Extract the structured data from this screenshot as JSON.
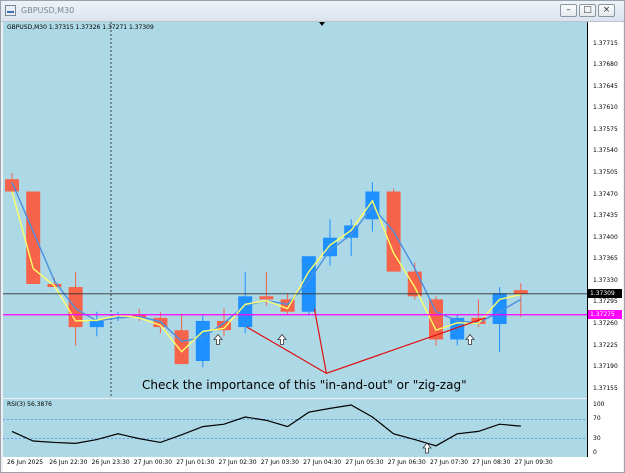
{
  "window": {
    "title": "GBPUSD,M30",
    "buttons": [
      "minimize",
      "maximize",
      "close"
    ]
  },
  "symbol_info": "GBPUSD,M30  1.37315 1.37326 1.37271 1.37309",
  "annotation": "Check the importance of this \"in-and-out\" or \"zig-zag\"",
  "price_axis": [
    "1.37715",
    "1.37680",
    "1.37645",
    "1.37610",
    "1.37575",
    "1.37540",
    "1.37505",
    "1.37470",
    "1.37435",
    "1.37400",
    "1.37365",
    "1.37330",
    "1.37295",
    "1.37260",
    "1.37225",
    "1.37190",
    "1.37155"
  ],
  "current_price": "1.37309",
  "level_price": "1.37275",
  "rsi_label": "RSI(3) 56.3876",
  "rsi_axis": [
    "100",
    "70",
    "30",
    "0"
  ],
  "time_axis": [
    "26 Jun 2025",
    "26 Jun 22:30",
    "26 Jun 23:30",
    "27 Jun 00:30",
    "27 Jun 01:30",
    "27 Jun 02:30",
    "27 Jun 03:30",
    "27 Jun 04:30",
    "27 Jun 05:30",
    "27 Jun 06:30",
    "27 Jun 07:30",
    "27 Jun 08:30",
    "27 Jun 09:30"
  ],
  "colors": {
    "background": "#add8e6",
    "bull": "#1e90ff",
    "bear": "#f4634a",
    "level": "#ff00ff",
    "zigzag": "#e01010",
    "ma_fast": "#ffff66",
    "ma_slow": "#4a90e2"
  },
  "chart_data": {
    "type": "candlestick",
    "y_range": [
      1.3714,
      1.3775
    ],
    "candles": [
      {
        "o": 1.37495,
        "h": 1.37505,
        "l": 1.37475,
        "c": 1.37475
      },
      {
        "o": 1.37475,
        "h": 1.37475,
        "l": 1.37325,
        "c": 1.37325
      },
      {
        "o": 1.37325,
        "h": 1.37335,
        "l": 1.3732,
        "c": 1.3732
      },
      {
        "o": 1.3732,
        "h": 1.37345,
        "l": 1.37225,
        "c": 1.37255
      },
      {
        "o": 1.37255,
        "h": 1.3728,
        "l": 1.3724,
        "c": 1.37265
      },
      {
        "o": 1.37275,
        "h": 1.3728,
        "l": 1.37265,
        "c": 1.37275
      },
      {
        "o": 1.37275,
        "h": 1.37285,
        "l": 1.37265,
        "c": 1.3727
      },
      {
        "o": 1.3727,
        "h": 1.3728,
        "l": 1.37245,
        "c": 1.37255
      },
      {
        "o": 1.3725,
        "h": 1.37275,
        "l": 1.37195,
        "c": 1.37195
      },
      {
        "o": 1.372,
        "h": 1.37275,
        "l": 1.3719,
        "c": 1.37265
      },
      {
        "o": 1.37265,
        "h": 1.37285,
        "l": 1.3724,
        "c": 1.3725
      },
      {
        "o": 1.37255,
        "h": 1.37345,
        "l": 1.37245,
        "c": 1.37305
      },
      {
        "o": 1.37305,
        "h": 1.37345,
        "l": 1.3729,
        "c": 1.373
      },
      {
        "o": 1.373,
        "h": 1.3731,
        "l": 1.37275,
        "c": 1.3728
      },
      {
        "o": 1.3728,
        "h": 1.37365,
        "l": 1.37275,
        "c": 1.3737
      },
      {
        "o": 1.3737,
        "h": 1.3743,
        "l": 1.37355,
        "c": 1.374
      },
      {
        "o": 1.374,
        "h": 1.3743,
        "l": 1.3737,
        "c": 1.3742
      },
      {
        "o": 1.3743,
        "h": 1.3749,
        "l": 1.3741,
        "c": 1.37475
      },
      {
        "o": 1.37475,
        "h": 1.3748,
        "l": 1.37345,
        "c": 1.37345
      },
      {
        "o": 1.37345,
        "h": 1.3736,
        "l": 1.373,
        "c": 1.37305
      },
      {
        "o": 1.373,
        "h": 1.37305,
        "l": 1.37225,
        "c": 1.37235
      },
      {
        "o": 1.37235,
        "h": 1.37275,
        "l": 1.37225,
        "c": 1.3727
      },
      {
        "o": 1.3727,
        "h": 1.373,
        "l": 1.37255,
        "c": 1.3726
      },
      {
        "o": 1.3726,
        "h": 1.3732,
        "l": 1.37215,
        "c": 1.3731
      },
      {
        "o": 1.37315,
        "h": 1.37326,
        "l": 1.37271,
        "c": 1.37309
      }
    ],
    "ma_fast": [
      1.37475,
      1.3735,
      1.37322,
      1.37265,
      1.37266,
      1.37274,
      1.3727,
      1.37258,
      1.37215,
      1.37248,
      1.37253,
      1.37292,
      1.37298,
      1.37285,
      1.37345,
      1.37388,
      1.37412,
      1.3746,
      1.37375,
      1.3732,
      1.3725,
      1.37262,
      1.37261,
      1.373,
      1.37308
    ],
    "ma_slow": [
      1.3749,
      1.3741,
      1.3733,
      1.37285,
      1.37265,
      1.3727,
      1.37272,
      1.37264,
      1.37232,
      1.37238,
      1.37262,
      1.3729,
      1.37298,
      1.37292,
      1.3733,
      1.3738,
      1.37405,
      1.3745,
      1.3741,
      1.3735,
      1.3728,
      1.37265,
      1.37262,
      1.3728,
      1.373
    ],
    "zigzag": [
      [
        11,
        1.37255
      ],
      [
        16,
        1.3718
      ],
      [
        26,
        1.3727
      ]
    ],
    "arrows": [
      11,
      15,
      26,
      27
    ],
    "rsi": [
      45,
      25,
      22,
      20,
      28,
      40,
      30,
      22,
      38,
      55,
      60,
      75,
      68,
      55,
      85,
      93,
      100,
      75,
      40,
      28,
      15,
      40,
      45,
      60,
      56
    ],
    "rsi_levels": [
      70,
      30
    ]
  }
}
